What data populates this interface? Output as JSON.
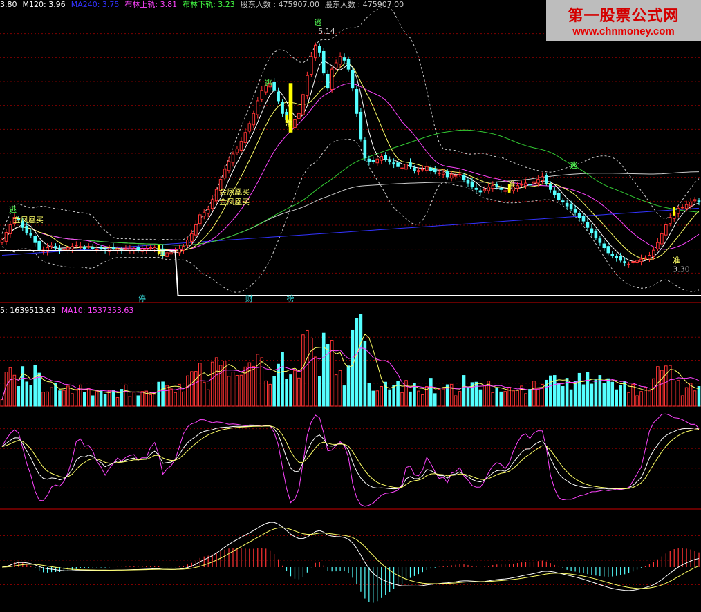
{
  "watermark": {
    "line1": "第一股票公式网",
    "line2": "www.chnmoney.com"
  },
  "header": {
    "main": [
      {
        "text": "3.80",
        "color": "#ffffff"
      },
      {
        "text": "M120: 3.96",
        "color": "#ffffff"
      },
      {
        "text": "MA240: 3.75",
        "color": "#3333ff"
      },
      {
        "text": "布林上轨: 3.81",
        "color": "#ff44ff"
      },
      {
        "text": "布林下轨: 3.23",
        "color": "#44ff44"
      },
      {
        "text": "股东人数 : 475907.00",
        "color": "#cccccc"
      },
      {
        "text": "股东人数 : 475907.00",
        "color": "#cccccc"
      }
    ],
    "volume": [
      {
        "text": "5: 1639513.63",
        "color": "#ffffff"
      },
      {
        "text": "MA10: 1537353.63",
        "color": "#ff44ff"
      }
    ]
  },
  "colors": {
    "up": "#ff3333",
    "down": "#55ffff",
    "ma_white": "#ffffff",
    "ma_yellow": "#ffff66",
    "ma_magenta": "#ff44ff",
    "ma_green": "#33cc33",
    "ma_blue": "#3333ff",
    "ma_grey": "#cccccc",
    "boll": "#cccccc",
    "grid": "#800000",
    "accent": "#ffff00"
  },
  "chart_data": [
    {
      "type": "candlestick",
      "panel": "price",
      "x": [
        1,
        2,
        3,
        4,
        5,
        6,
        7,
        8,
        9,
        10,
        11,
        12,
        13,
        14,
        15,
        16,
        17,
        18,
        19,
        20,
        21,
        22,
        23,
        24,
        25,
        26,
        27,
        28,
        29,
        30,
        31,
        32,
        33,
        34,
        35,
        36,
        37,
        38,
        39,
        40,
        41,
        42,
        43,
        44,
        45,
        46,
        47,
        48,
        49,
        50,
        51,
        52,
        53,
        54,
        55,
        56,
        57,
        58,
        59,
        60,
        61,
        62,
        63,
        64,
        65,
        66,
        67,
        68,
        69,
        70,
        71,
        72,
        73,
        74,
        75,
        76,
        77,
        78,
        79,
        80,
        81,
        82,
        83,
        84,
        85,
        86,
        87,
        88,
        89,
        90,
        91,
        92,
        93,
        94,
        95,
        96,
        97,
        98,
        99,
        100,
        101,
        102,
        103,
        104,
        105,
        106,
        107,
        108,
        109,
        110,
        111,
        112,
        113,
        114,
        115,
        116,
        117,
        118,
        119,
        120,
        121,
        122,
        123,
        124,
        125,
        126,
        127,
        128,
        129,
        130,
        131,
        132,
        133,
        134,
        135,
        136,
        137,
        138,
        139,
        140,
        141,
        142,
        143,
        144,
        145,
        146,
        147,
        148,
        149,
        150,
        151,
        152,
        153,
        154,
        155,
        156,
        157,
        158,
        159,
        160,
        161,
        162,
        163,
        164,
        165,
        166,
        167,
        168,
        169,
        170
      ],
      "close": [
        3.5,
        3.56,
        3.62,
        3.68,
        3.66,
        3.6,
        3.56,
        3.54,
        3.48,
        3.42,
        3.42,
        3.44,
        3.46,
        3.44,
        3.42,
        3.43,
        3.44,
        3.45,
        3.46,
        3.45,
        3.44,
        3.45,
        3.44,
        3.43,
        3.43,
        3.42,
        3.43,
        3.43,
        3.43,
        3.42,
        3.43,
        3.43,
        3.43,
        3.42,
        3.43,
        3.43,
        3.44,
        3.44,
        3.42,
        3.38,
        3.4,
        3.4,
        3.41,
        3.43,
        3.45,
        3.5,
        3.55,
        3.62,
        3.7,
        3.72,
        3.74,
        3.82,
        3.9,
        3.98,
        4.06,
        4.12,
        4.18,
        4.22,
        4.28,
        4.35,
        4.42,
        4.5,
        4.6,
        4.68,
        4.72,
        4.74,
        4.68,
        4.6,
        4.5,
        4.45,
        4.4,
        4.45,
        4.5,
        4.65,
        4.8,
        4.95,
        5.04,
        4.98,
        4.82,
        4.7,
        4.85,
        4.9,
        4.95,
        4.92,
        4.85,
        4.7,
        4.5,
        4.3,
        4.15,
        4.12,
        4.12,
        4.14,
        4.16,
        4.14,
        4.12,
        4.1,
        4.08,
        4.07,
        4.1,
        4.08,
        4.05,
        4.05,
        4.06,
        4.08,
        4.05,
        4.04,
        4.03,
        4.03,
        4.0,
        4.02,
        4.01,
        4.02,
        3.98,
        3.95,
        3.92,
        3.9,
        3.88,
        3.9,
        3.92,
        3.93,
        3.92,
        3.9,
        3.89,
        3.9,
        3.92,
        3.93,
        3.94,
        3.95,
        3.94,
        3.96,
        3.98,
        4.0,
        3.95,
        3.9,
        3.86,
        3.82,
        3.8,
        3.77,
        3.75,
        3.72,
        3.68,
        3.65,
        3.6,
        3.56,
        3.52,
        3.48,
        3.44,
        3.4,
        3.38,
        3.36,
        3.34,
        3.32,
        3.31,
        3.33,
        3.34,
        3.35,
        3.36,
        3.38,
        3.42,
        3.48,
        3.55,
        3.62,
        3.68,
        3.72,
        3.75,
        3.76,
        3.78,
        3.8,
        3.82,
        3.8
      ],
      "annotations": [
        {
          "text": "逃",
          "x": 2,
          "price": 3.72,
          "color": "#55ff55"
        },
        {
          "text": "金凤凰买",
          "x": 3,
          "price": 3.64,
          "color": "#ffff66"
        },
        {
          "text": "准",
          "x": 38,
          "price": 3.38,
          "color": "#ffff66"
        },
        {
          "text": "金凤凰买",
          "x": 53,
          "price": 3.86,
          "color": "#ffff66"
        },
        {
          "text": "金凤凰买",
          "x": 53,
          "price": 3.78,
          "color": "#ffff66"
        },
        {
          "text": "逃",
          "x": 64,
          "price": 4.72,
          "color": "#55ff55"
        },
        {
          "text": "准",
          "x": 69,
          "price": 4.4,
          "color": "#ffff66"
        },
        {
          "text": "逃",
          "x": 76,
          "price": 5.2,
          "color": "#55ff55"
        },
        {
          "text": "5.14",
          "x": 77,
          "price": 5.13,
          "color": "#cccccc"
        },
        {
          "text": "准",
          "x": 123,
          "price": 3.92,
          "color": "#ffff66"
        },
        {
          "text": "逃",
          "x": 138,
          "price": 4.07,
          "color": "#55ff55"
        },
        {
          "text": "准",
          "x": 163,
          "price": 3.32,
          "color": "#ffff66"
        },
        {
          "text": "3.30",
          "x": 163,
          "price": 3.25,
          "color": "#cccccc"
        }
      ],
      "bottom_labels": [
        {
          "text": "停",
          "x": 34
        },
        {
          "text": "财",
          "x": 60
        },
        {
          "text": "榜",
          "x": 70
        }
      ],
      "plateau": {
        "x_start": 0,
        "x_mid": 43,
        "x_end": 170,
        "value": "stage"
      }
    },
    {
      "type": "bar",
      "panel": "volume",
      "series": [
        {
          "name": "5",
          "values": []
        },
        {
          "name": "MA10",
          "values": []
        }
      ]
    },
    {
      "type": "line",
      "panel": "oscillator",
      "ylim": [
        -1,
        1
      ]
    },
    {
      "type": "bar",
      "panel": "macd",
      "ylim": [
        -1,
        1
      ]
    }
  ]
}
